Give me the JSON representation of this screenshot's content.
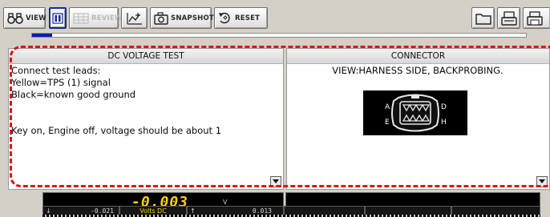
{
  "toolbar": {
    "view_label": "VIEW",
    "review_label": "REVIEW",
    "snapshot_label": "SNAPSHOT",
    "reset_label": "RESET"
  },
  "progress": {
    "fraction": 0.04
  },
  "dc_panel": {
    "title": "DC VOLTAGE TEST",
    "lines": [
      "Connect test leads:",
      "Yellow=TPS (1) signal",
      "Black=known good ground",
      "",
      "",
      "Key on, Engine off, voltage should be about 1"
    ]
  },
  "connector_panel": {
    "title": "CONNECTOR",
    "view_text": "VIEW:HARNESS SIDE, BACKPROBING.",
    "pin_labels": {
      "a": "A",
      "d": "D",
      "e": "E",
      "h": "H"
    }
  },
  "meter": {
    "value": "-0.003",
    "unit": "V",
    "min_value": "-0.021",
    "mode": "Volts DC",
    "max_value": "0.013"
  },
  "colors": {
    "callout_dashes": "#e01414",
    "meter_value": "#ffd400",
    "progress_fill": "#0b1ea8",
    "active_button_border": "#1a2a8c"
  },
  "icons": [
    "binoculars-icon",
    "pause-icon",
    "review-icon",
    "mark-icon",
    "camera-icon",
    "reset-icon",
    "folder-icon",
    "print-icon",
    "printer-icon",
    "arrow-down-icon"
  ]
}
